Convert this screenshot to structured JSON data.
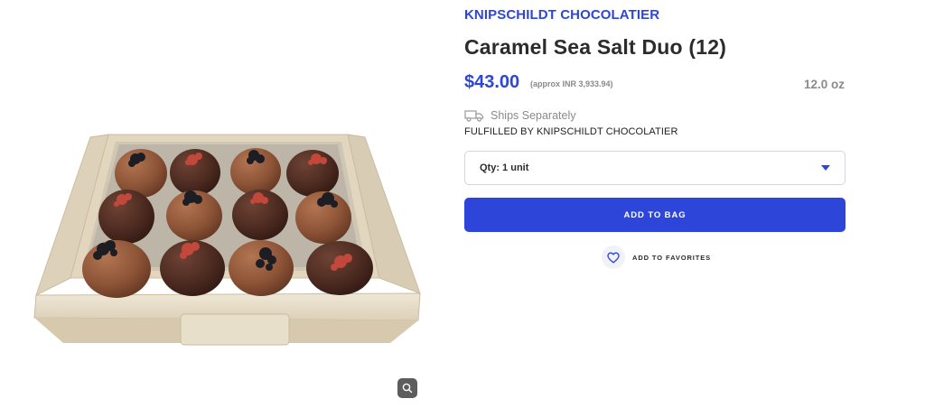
{
  "product": {
    "brand": "KNIPSCHILDT CHOCOLATIER",
    "title": "Caramel Sea Salt Duo (12)",
    "price": "$43.00",
    "price_approx": "(approx INR 3,933.94)",
    "size": "12.0 oz",
    "shipping": "Ships Separately",
    "fulfilled_by": "FULFILLED BY KNIPSCHILDT CHOCOLATIER"
  },
  "quantity": {
    "selected": "Qty: 1 unit"
  },
  "actions": {
    "add_to_bag": "ADD TO BAG",
    "add_to_favorites": "ADD TO FAVORITES"
  },
  "icons": {
    "truck": "truck-icon",
    "heart": "heart-icon",
    "zoom": "zoom-icon",
    "caret": "caret-down-icon"
  },
  "colors": {
    "accent": "#2d46d9",
    "muted_text": "#8a8a8a",
    "favorite_bg": "#f1f2f6"
  }
}
